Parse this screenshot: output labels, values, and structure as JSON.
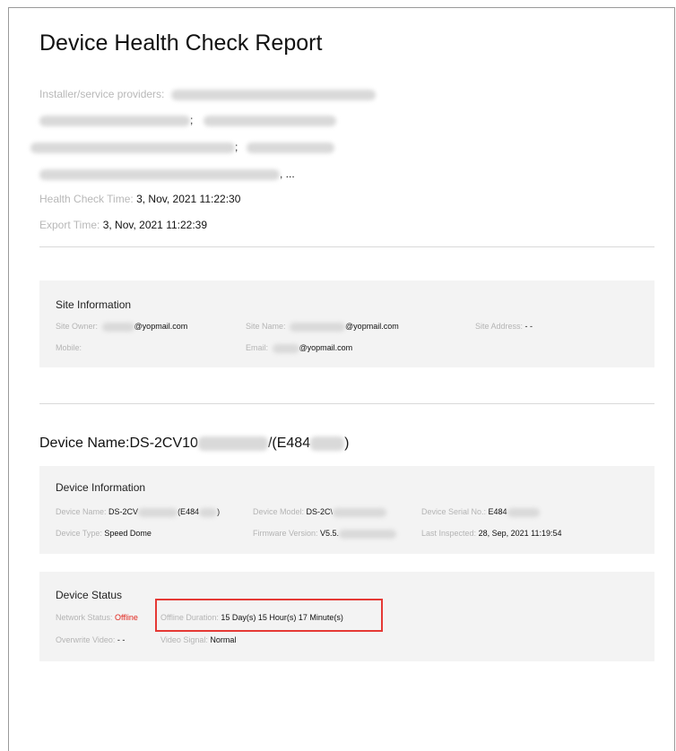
{
  "report": {
    "title": "Device Health Check Report",
    "installer_label": "Installer/service providers:",
    "sep_semicolon": ";",
    "sep_semicolon2": ";",
    "ellipsis": ", ...",
    "health_check_label": "Health Check Time:",
    "health_check_value": "3, Nov, 2021 11:22:30",
    "export_label": "Export Time:",
    "export_value": "3, Nov, 2021 11:22:39"
  },
  "site": {
    "title": "Site Information",
    "owner_label": "Site Owner:",
    "owner_value": "@yopmail.com",
    "name_label": "Site Name:",
    "name_value": "@yopmail.com",
    "address_label": "Site Address:",
    "address_value": "- -",
    "mobile_label": "Mobile:",
    "email_label": "Email:",
    "email_value": "@yopmail.com"
  },
  "device": {
    "heading_prefix": "Device Name:DS-2CV10",
    "heading_mid": "/(E484",
    "heading_suffix": ")",
    "info_title": "Device Information",
    "name_label": "Device Name:",
    "name_value_a": "DS-2CV",
    "name_value_b": "(E484",
    "name_value_c": ")",
    "model_label": "Device Model:",
    "model_value": "DS-2C\\",
    "serial_label": "Device Serial No.:",
    "serial_value": "E484",
    "type_label": "Device Type:",
    "type_value": "Speed Dome",
    "firmware_label": "Firmware Version:",
    "firmware_value": "V5.5.",
    "inspected_label": "Last Inspected:",
    "inspected_value": "28, Sep, 2021 11:19:54"
  },
  "status": {
    "title": "Device Status",
    "network_label": "Network Status:",
    "network_value": "Offline",
    "offline_duration_label": "Offline Duration:",
    "offline_duration_value": "15 Day(s) 15 Hour(s) 17 Minute(s)",
    "overwrite_label": "Overwrite Video:",
    "overwrite_value": "- -",
    "signal_label": "Video Signal:",
    "signal_value": "Normal"
  },
  "colors": {
    "offline": "#e0261d",
    "highlight": "#e53935",
    "panel_bg": "#f3f3f3"
  }
}
